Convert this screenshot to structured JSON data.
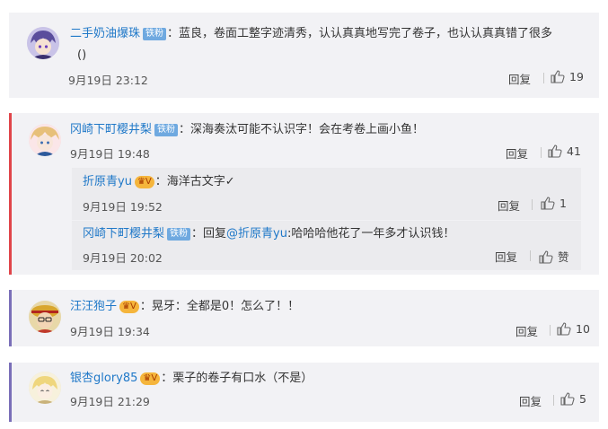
{
  "comments": [
    {
      "user": "二手奶油爆珠",
      "badge": "铁粉",
      "text_line1": "：蓝良，卷面工整字迹清秀，认认真真地写完了卷子，也认认真真错了很多",
      "text_line2": "()",
      "time": "9月19日 23:12",
      "reply_label": "回复",
      "likes": "19"
    },
    {
      "user": "冈崎下町樱井梨",
      "badge": "铁粉",
      "text": "：深海奏汰可能不认识字！会在考卷上画小鱼！",
      "time": "9月19日 19:48",
      "reply_label": "回复",
      "likes": "41",
      "replies": [
        {
          "user": "折原青yu",
          "text": "：海洋古文字✓",
          "time": "9月19日 19:52",
          "reply_label": "回复",
          "likes": "1"
        },
        {
          "user": "冈崎下町樱井梨",
          "badge": "铁粉",
          "reply_prefix": "：回复",
          "mention": "@折原青yu",
          "text": ":哈哈哈他花了一年多才认识钱！",
          "time": "9月19日 20:02",
          "reply_label": "回复",
          "likes": "赞"
        }
      ]
    },
    {
      "user": "汪汪狍子",
      "text": "：晃牙：全都是0！怎么了！！",
      "time": "9月19日 19:34",
      "reply_label": "回复",
      "likes": "10"
    },
    {
      "user": "银杏glory85",
      "text": "：栗子的卷子有口水（不是）",
      "time": "9月19日 21:29",
      "reply_label": "回复",
      "likes": "5"
    }
  ],
  "colors": {
    "username": "#1f78c8",
    "card_bg": "#f2f2f5",
    "sub_bg": "#ebebee",
    "accent_bar": "#e0454a",
    "accent_bar_2": "#7a6fb8"
  },
  "icons": [
    "thumb-up-icon",
    "avatar-anime-1",
    "avatar-anime-2",
    "avatar-anime-3",
    "avatar-anime-4"
  ]
}
